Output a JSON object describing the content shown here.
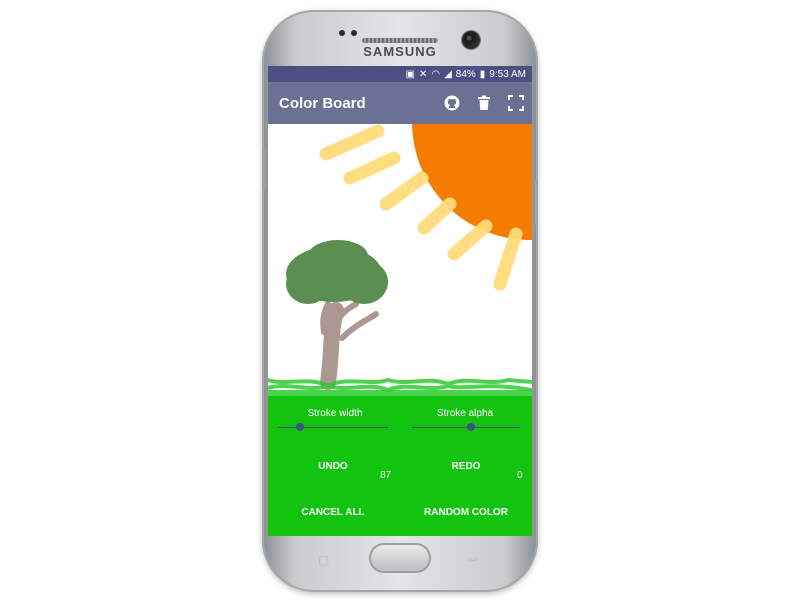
{
  "device": {
    "brand": "SAMSUNG"
  },
  "status_bar": {
    "battery": "84%",
    "time": "9:53 AM"
  },
  "app_bar": {
    "title": "Color Board",
    "actions": [
      "github-icon",
      "trash-icon",
      "fullscreen-icon"
    ]
  },
  "colors": {
    "status_bar": "#495082",
    "app_bar": "#6b7195",
    "controls_bg": "#12c40f",
    "slider_accent": "#3f4f85",
    "sun_orange": "#f57c00",
    "sun_ray": "#ffdc7a",
    "grass": "#2ecc2e",
    "tree_canopy": "#5b8f52",
    "tree_trunk": "#a58d86"
  },
  "controls": {
    "stroke_width": {
      "label": "Stroke width",
      "value": 0.2
    },
    "stroke_alpha": {
      "label": "Stroke alpha",
      "value": 0.55
    },
    "undo_label": "UNDO",
    "redo_label": "REDO",
    "undo_count": "87",
    "redo_count": "0",
    "cancel_all_label": "CANCEL ALL",
    "random_color_label": "RANDOM COLOR"
  }
}
